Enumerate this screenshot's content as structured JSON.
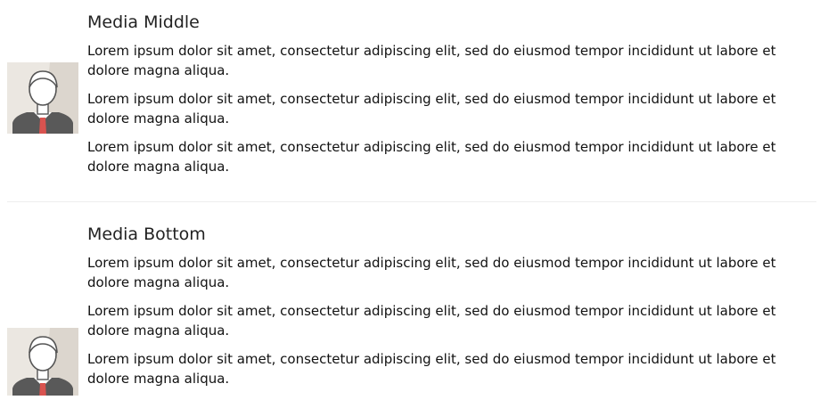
{
  "media_middle": {
    "heading": "Media Middle",
    "paragraphs": [
      "Lorem ipsum dolor sit amet, consectetur adipiscing elit, sed do eiusmod tempor incididunt ut labore et dolore magna aliqua.",
      "Lorem ipsum dolor sit amet, consectetur adipiscing elit, sed do eiusmod tempor incididunt ut labore et dolore magna aliqua.",
      "Lorem ipsum dolor sit amet, consectetur adipiscing elit, sed do eiusmod tempor incididunt ut labore et dolore magna aliqua."
    ],
    "avatar_icon": "user-avatar-icon"
  },
  "media_bottom": {
    "heading": "Media Bottom",
    "paragraphs": [
      "Lorem ipsum dolor sit amet, consectetur adipiscing elit, sed do eiusmod tempor incididunt ut labore et dolore magna aliqua.",
      "Lorem ipsum dolor sit amet, consectetur adipiscing elit, sed do eiusmod tempor incididunt ut labore et dolore magna aliqua.",
      "Lorem ipsum dolor sit amet, consectetur adipiscing elit, sed do eiusmod tempor incididunt ut labore et dolore magna aliqua."
    ],
    "avatar_icon": "user-avatar-icon"
  },
  "colors": {
    "text": "#111111",
    "divider": "#eeeeee",
    "avatar_bg": "#e8e4de",
    "avatar_shirt": "#555555",
    "avatar_tie": "#d9534f"
  }
}
